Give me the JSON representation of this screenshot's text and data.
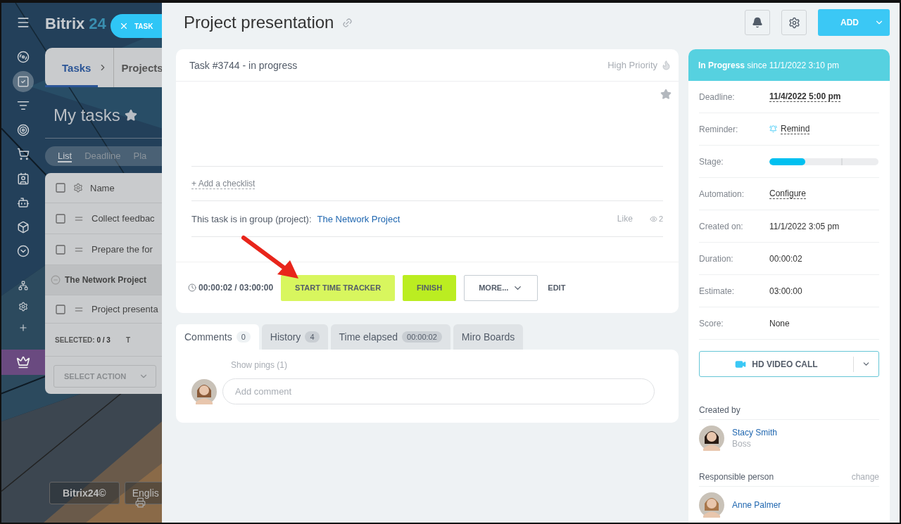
{
  "left_page": {
    "logo": {
      "name": "Bitrix",
      "number": "24"
    },
    "task_tab": {
      "label": "TASK"
    },
    "sidebar": {
      "items": [
        {
          "selected": false
        },
        {
          "selected": true
        },
        {
          "selected": false
        },
        {
          "selected": false
        },
        {
          "selected": false
        },
        {
          "selected": false
        },
        {
          "selected": false
        },
        {
          "selected": false
        },
        {
          "selected": false
        },
        {
          "selected": false
        },
        {
          "selected": false
        },
        {
          "selected": false
        }
      ]
    },
    "breadcrumbs": [
      {
        "label": "Tasks",
        "selected": true
      },
      {
        "label": "Projects",
        "selected": false
      }
    ],
    "heading": "My tasks",
    "view_tabs": [
      {
        "label": "List",
        "selected": true
      },
      {
        "label": "Deadline",
        "selected": false
      },
      {
        "label": "Pla",
        "selected": false
      }
    ],
    "table": {
      "column": "Name",
      "all_checked": false,
      "rows": [
        {
          "kind": "task",
          "title": "Collect feedbac",
          "checked": false
        },
        {
          "kind": "task",
          "title": "Prepare the for",
          "checked": false
        },
        {
          "kind": "group",
          "title": "The Network Project"
        },
        {
          "kind": "task",
          "title": "Project presenta",
          "checked": false
        }
      ],
      "selected_label": "SELECTED:",
      "selected_count": "0 / 3",
      "total_label": "T",
      "action": "SELECT ACTION"
    },
    "footer_buttons": [
      "Bitrix24©",
      "Englis"
    ]
  },
  "task": {
    "title": "Project presentation",
    "add_button": "ADD",
    "header": "Task #3744 - in progress",
    "priority": "High Priority",
    "checklist_link": "+ Add a checklist",
    "group_label": "This task is in group (project):",
    "group_link": "The Network Project",
    "like": "Like",
    "views": "2",
    "timer": "00:00:02 / 03:00:00",
    "buttons": [
      {
        "kind": "tracker",
        "label": "START TIME TRACKER"
      },
      {
        "kind": "finish",
        "label": "FINISH"
      },
      {
        "kind": "more",
        "label": "MORE..."
      },
      {
        "kind": "plain",
        "label": "EDIT"
      }
    ]
  },
  "tabs": [
    {
      "label": "Comments",
      "count": "0",
      "selected": true
    },
    {
      "label": "History",
      "count": "4",
      "selected": false
    },
    {
      "label": "Time elapsed",
      "count": "00:00:02",
      "selected": false
    },
    {
      "label": "Miro Boards",
      "selected": false
    }
  ],
  "comments": {
    "show_pings": "Show pings (1)",
    "placeholder": "Add comment"
  },
  "details": {
    "status": "**In Progress** since 11/1/2022 3:10 pm",
    "fields": [
      {
        "kind": "date",
        "label": "Deadline:",
        "value": "11/4/2022 5:00 pm"
      },
      {
        "kind": "remind",
        "label": "Reminder:",
        "value": "Remind"
      },
      {
        "kind": "stage",
        "label": "Stage:",
        "level": 0.33
      },
      {
        "kind": "link",
        "label": "Automation:",
        "value": "Configure"
      },
      {
        "kind": "text",
        "label": "Created on:",
        "value": "11/1/2022 3:05 pm"
      },
      {
        "kind": "text",
        "label": "Duration:",
        "value": "00:00:02"
      },
      {
        "kind": "text",
        "label": "Estimate:",
        "value": "03:00:00"
      },
      {
        "kind": "text",
        "label": "Score:",
        "value": "None"
      }
    ],
    "video_call": "HD VIDEO CALL",
    "created_by": {
      "heading": "Created by",
      "name": "Stacy Smith",
      "role": "Boss"
    },
    "responsible": {
      "heading": "Responsible person",
      "action": "change",
      "name": "Anne Palmer"
    }
  }
}
